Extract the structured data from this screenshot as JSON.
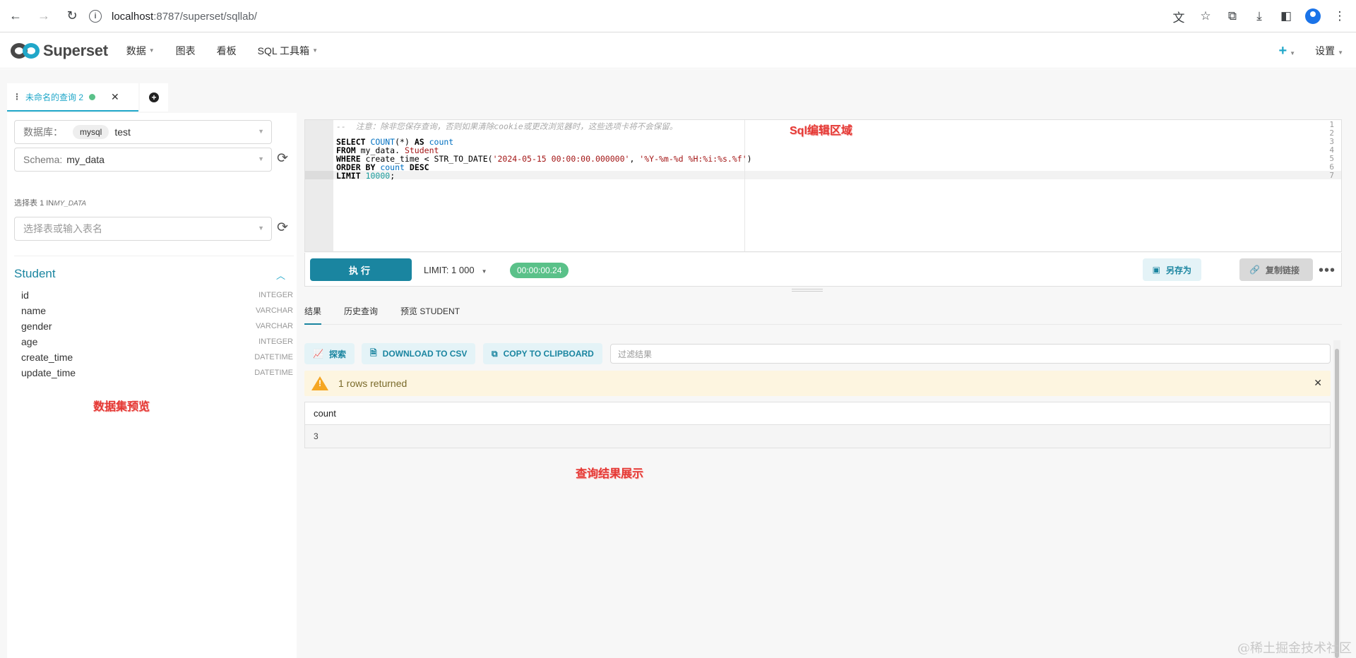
{
  "browser": {
    "url_host": "localhost",
    "url_rest": ":8787/superset/sqllab/"
  },
  "app": {
    "logo_text": "Superset",
    "menu": [
      {
        "label": "数据"
      },
      {
        "label": "图表"
      },
      {
        "label": "看板"
      },
      {
        "label": "SQL 工具箱"
      }
    ],
    "settings_label": "设置"
  },
  "query_tab": {
    "title": "未命名的查询 2"
  },
  "left_panel": {
    "database_label": "数据库：",
    "database_type": "mysql",
    "database_name": "test",
    "schema_label": "Schema:",
    "schema_value": "my_data",
    "select_table_label": "选择表",
    "select_table_count": "1 IN",
    "select_table_schema": "MY_DATA",
    "table_placeholder": "选择表或输入表名",
    "table_name": "Student",
    "columns": [
      {
        "name": "id",
        "type": "INTEGER"
      },
      {
        "name": "name",
        "type": "VARCHAR"
      },
      {
        "name": "gender",
        "type": "VARCHAR"
      },
      {
        "name": "age",
        "type": "INTEGER"
      },
      {
        "name": "create_time",
        "type": "DATETIME"
      },
      {
        "name": "update_time",
        "type": "DATETIME"
      }
    ],
    "annotation": "数据集预览"
  },
  "editor": {
    "line_numbers": [
      "1",
      "2",
      "3",
      "4",
      "5",
      "6",
      "7"
    ],
    "comment": "--  注意：除非您保存查询，否则如果清除cookie或更改浏览器时，这些选项卡将不会保留。",
    "annotation": "Sql编辑区域",
    "run_label": "执行",
    "limit_label": "LIMIT:",
    "limit_value": "1 000",
    "timer": "00:00:00.24",
    "save_as_label": "另存为",
    "copy_link_label": "复制链接"
  },
  "results": {
    "tabs": [
      "结果",
      "历史查询",
      "预览 STUDENT"
    ],
    "explore_label": "探索",
    "download_csv_label": "DOWNLOAD TO CSV",
    "copy_clipboard_label": "COPY TO CLIPBOARD",
    "filter_placeholder": "过滤结果",
    "alert_message": "1 rows returned",
    "column_header": "count",
    "rows": [
      "3"
    ],
    "annotation": "查询结果展示"
  },
  "watermark": "@稀土掘金技术社区"
}
